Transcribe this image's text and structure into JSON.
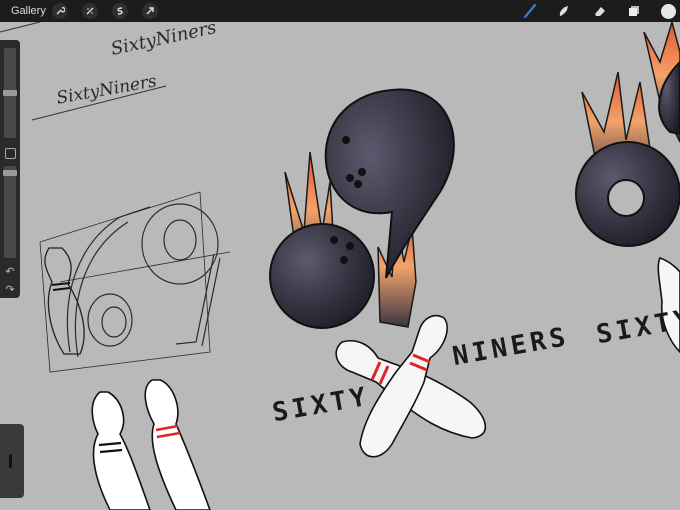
{
  "toolbar": {
    "gallery_label": "Gallery",
    "left_icons": [
      "wrench-icon",
      "magic-wand-icon",
      "selection-icon",
      "transform-icon"
    ],
    "right_icons": [
      "brush-icon",
      "smudge-icon",
      "eraser-icon",
      "layers-icon"
    ],
    "active_color": "#e6e6e6",
    "brush_accent": "#3a7bd5"
  },
  "canvas": {
    "background": "#b9b9b9",
    "sketch_words": [
      "SixtyNiners",
      "SixtyNiners"
    ],
    "logo_words": [
      "SIXTY",
      "NINERS",
      "SIXTY"
    ]
  },
  "sidebar": {
    "size_slider_level": 0.5,
    "opacity_slider_level": 0.95
  }
}
